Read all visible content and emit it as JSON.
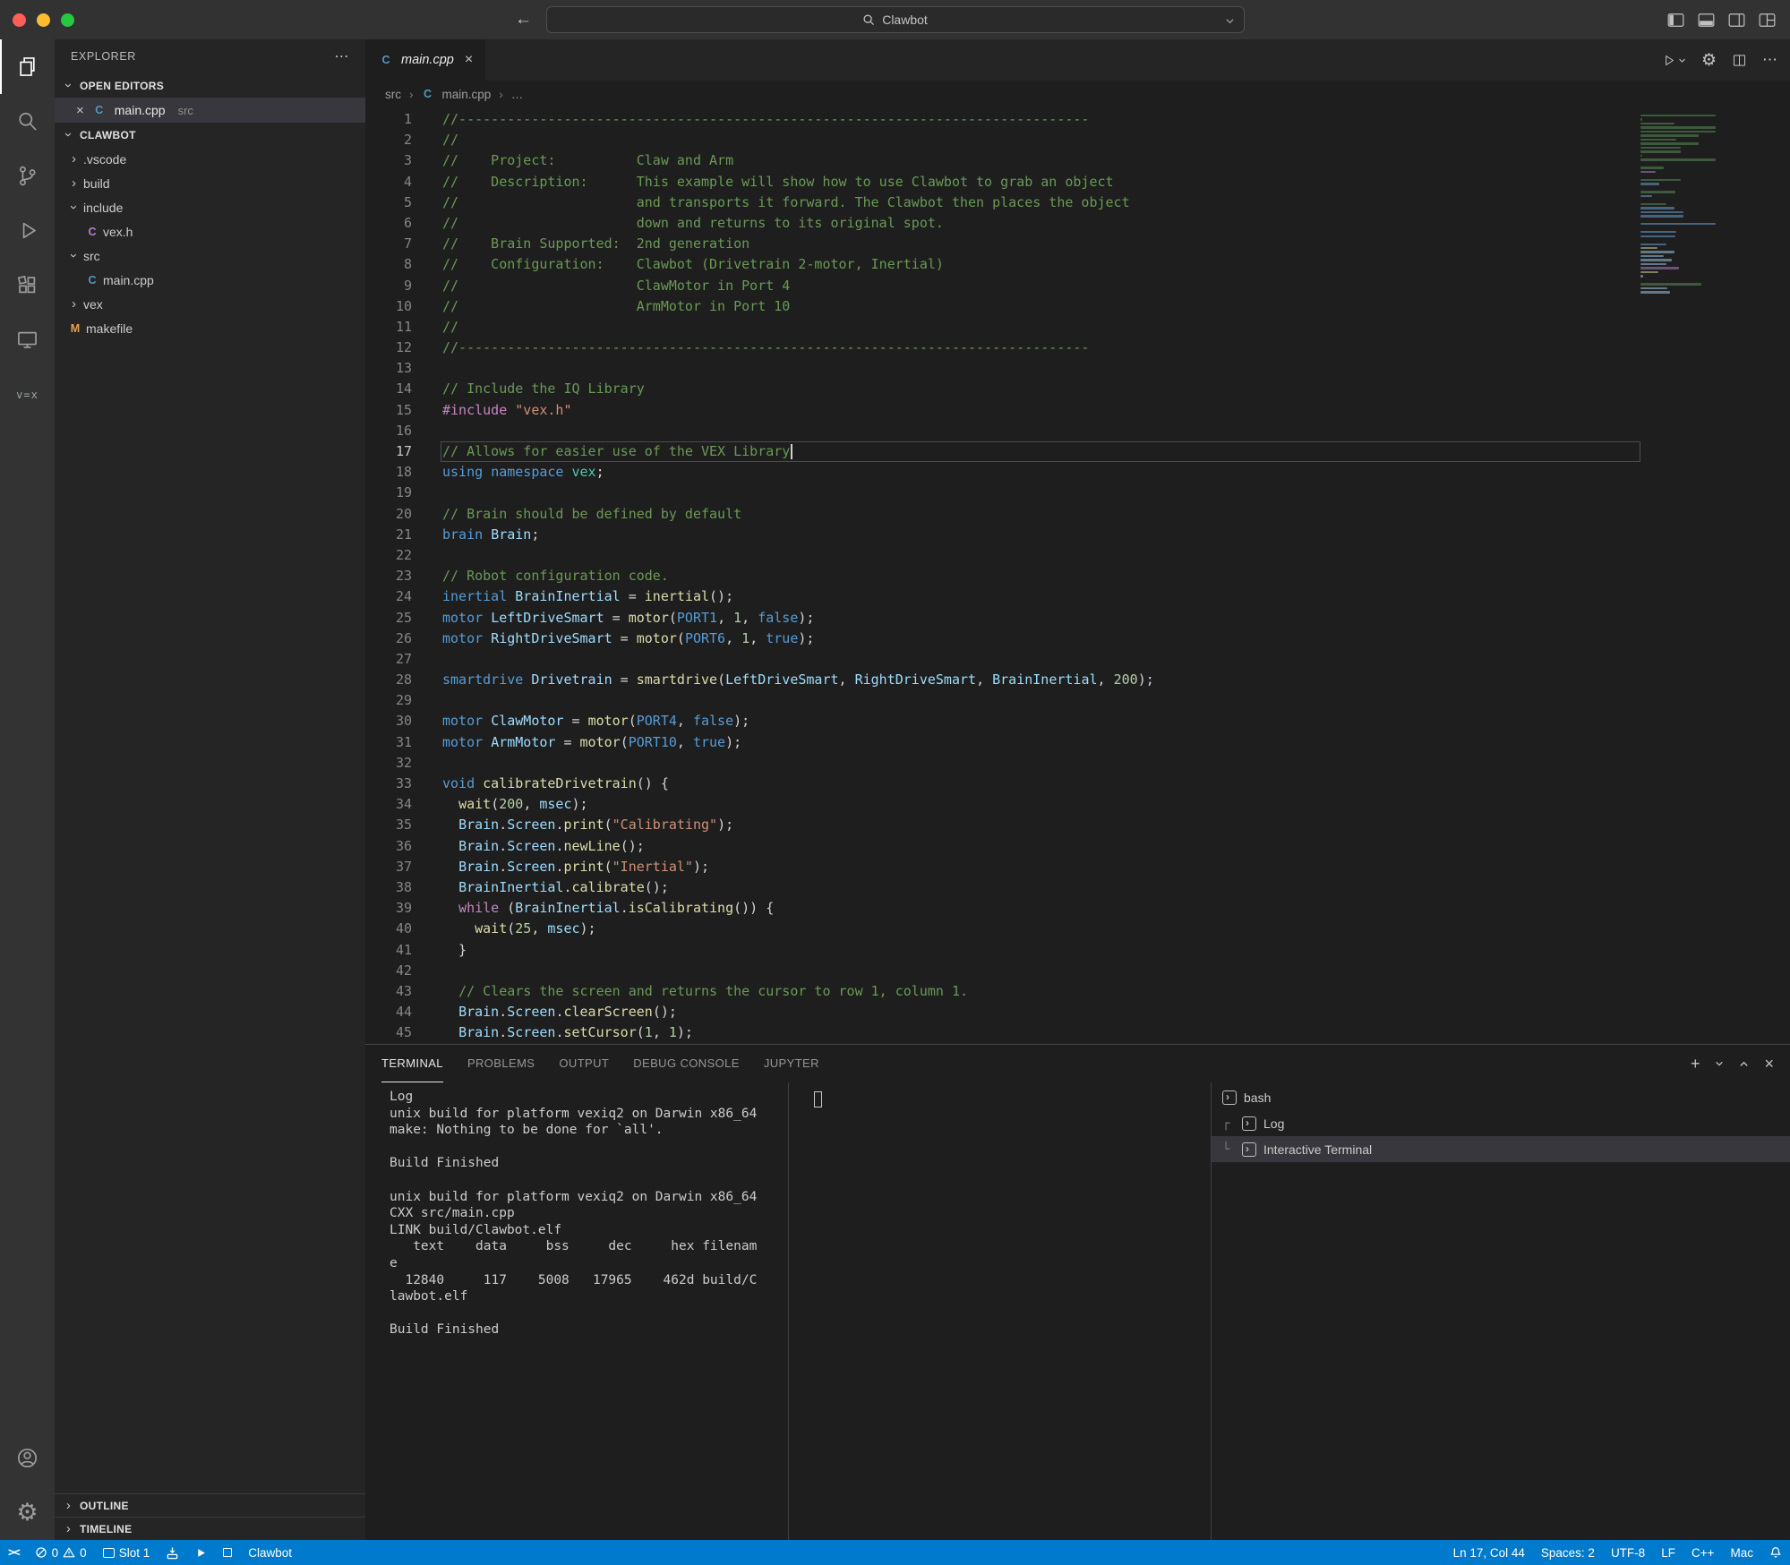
{
  "titlebar": {
    "search_value": "Clawbot"
  },
  "icons": {
    "close": "×",
    "more": "⋯",
    "plus": "+",
    "back": "←",
    "forward": "→"
  },
  "sidebar": {
    "title": "EXPLORER",
    "open_editors_header": "OPEN EDITORS",
    "open_editor_item": {
      "label": "main.cpp",
      "detail": "src",
      "icon_glyph": "C",
      "icon_color": "#519aba"
    },
    "workspace_header": "CLAWBOT",
    "tree": [
      {
        "label": ".vscode",
        "type": "folder",
        "depth": 0,
        "expanded": false
      },
      {
        "label": "build",
        "type": "folder",
        "depth": 0,
        "expanded": false
      },
      {
        "label": "include",
        "type": "folder",
        "depth": 0,
        "expanded": true
      },
      {
        "label": "vex.h",
        "type": "file",
        "depth": 1,
        "glyph": "C",
        "color": "#b180d7"
      },
      {
        "label": "src",
        "type": "folder",
        "depth": 0,
        "expanded": true
      },
      {
        "label": "main.cpp",
        "type": "file",
        "depth": 1,
        "glyph": "C",
        "color": "#519aba"
      },
      {
        "label": "vex",
        "type": "folder",
        "depth": 0,
        "expanded": false
      },
      {
        "label": "makefile",
        "type": "file",
        "depth": 0,
        "glyph": "M",
        "color": "#e8a04c"
      }
    ],
    "outline_label": "OUTLINE",
    "timeline_label": "TIMELINE"
  },
  "editor": {
    "tab_label": "main.cpp",
    "tab_icon": {
      "glyph": "C",
      "color": "#519aba"
    },
    "breadcrumbs": [
      "src",
      "main.cpp",
      "…"
    ],
    "cursor_line": 17,
    "lines": [
      [
        [
          "c",
          "//------------------------------------------------------------------------------"
        ]
      ],
      [
        [
          "c",
          "//"
        ]
      ],
      [
        [
          "c",
          "//    Project:          Claw and Arm"
        ]
      ],
      [
        [
          "c",
          "//    Description:      This example will show how to use Clawbot to grab an object"
        ]
      ],
      [
        [
          "c",
          "//                      and transports it forward. The Clawbot then places the object"
        ]
      ],
      [
        [
          "c",
          "//                      down and returns to its original spot."
        ]
      ],
      [
        [
          "c",
          "//    Brain Supported:  2nd generation"
        ]
      ],
      [
        [
          "c",
          "//    Configuration:    Clawbot (Drivetrain 2-motor, Inertial)"
        ]
      ],
      [
        [
          "c",
          "//                      ClawMotor in Port 4"
        ]
      ],
      [
        [
          "c",
          "//                      ArmMotor in Port 10"
        ]
      ],
      [
        [
          "c",
          "//"
        ]
      ],
      [
        [
          "c",
          "//------------------------------------------------------------------------------"
        ]
      ],
      [],
      [
        [
          "c",
          "// Include the IQ Library"
        ]
      ],
      [
        [
          "m",
          "#include"
        ],
        [
          "p",
          " "
        ],
        [
          "s",
          "\"vex.h\""
        ]
      ],
      [],
      [
        [
          "c",
          "// Allows for easier use of the VEX Library"
        ]
      ],
      [
        [
          "k",
          "using"
        ],
        [
          "p",
          " "
        ],
        [
          "k",
          "namespace"
        ],
        [
          "p",
          " "
        ],
        [
          "e",
          "vex"
        ],
        [
          "p",
          ";"
        ]
      ],
      [],
      [
        [
          "c",
          "// Brain should be defined by default"
        ]
      ],
      [
        [
          "k",
          "brain"
        ],
        [
          "p",
          " "
        ],
        [
          "v",
          "Brain"
        ],
        [
          "p",
          ";"
        ]
      ],
      [],
      [
        [
          "c",
          "// Robot configuration code."
        ]
      ],
      [
        [
          "k",
          "inertial"
        ],
        [
          "p",
          " "
        ],
        [
          "v",
          "BrainInertial"
        ],
        [
          "p",
          " = "
        ],
        [
          "f",
          "inertial"
        ],
        [
          "p",
          "();"
        ]
      ],
      [
        [
          "k",
          "motor"
        ],
        [
          "p",
          " "
        ],
        [
          "v",
          "LeftDriveSmart"
        ],
        [
          "p",
          " = "
        ],
        [
          "f",
          "motor"
        ],
        [
          "p",
          "("
        ],
        [
          "k",
          "PORT1"
        ],
        [
          "p",
          ", "
        ],
        [
          "n",
          "1"
        ],
        [
          "p",
          ", "
        ],
        [
          "k",
          "false"
        ],
        [
          "p",
          ");"
        ]
      ],
      [
        [
          "k",
          "motor"
        ],
        [
          "p",
          " "
        ],
        [
          "v",
          "RightDriveSmart"
        ],
        [
          "p",
          " = "
        ],
        [
          "f",
          "motor"
        ],
        [
          "p",
          "("
        ],
        [
          "k",
          "PORT6"
        ],
        [
          "p",
          ", "
        ],
        [
          "n",
          "1"
        ],
        [
          "p",
          ", "
        ],
        [
          "k",
          "true"
        ],
        [
          "p",
          ");"
        ]
      ],
      [],
      [
        [
          "k",
          "smartdrive"
        ],
        [
          "p",
          " "
        ],
        [
          "v",
          "Drivetrain"
        ],
        [
          "p",
          " = "
        ],
        [
          "f",
          "smartdrive"
        ],
        [
          "p",
          "("
        ],
        [
          "v",
          "LeftDriveSmart"
        ],
        [
          "p",
          ", "
        ],
        [
          "v",
          "RightDriveSmart"
        ],
        [
          "p",
          ", "
        ],
        [
          "v",
          "BrainInertial"
        ],
        [
          "p",
          ", "
        ],
        [
          "n",
          "200"
        ],
        [
          "p",
          ");"
        ]
      ],
      [],
      [
        [
          "k",
          "motor"
        ],
        [
          "p",
          " "
        ],
        [
          "v",
          "ClawMotor"
        ],
        [
          "p",
          " = "
        ],
        [
          "f",
          "motor"
        ],
        [
          "p",
          "("
        ],
        [
          "k",
          "PORT4"
        ],
        [
          "p",
          ", "
        ],
        [
          "k",
          "false"
        ],
        [
          "p",
          ");"
        ]
      ],
      [
        [
          "k",
          "motor"
        ],
        [
          "p",
          " "
        ],
        [
          "v",
          "ArmMotor"
        ],
        [
          "p",
          " = "
        ],
        [
          "f",
          "motor"
        ],
        [
          "p",
          "("
        ],
        [
          "k",
          "PORT10"
        ],
        [
          "p",
          ", "
        ],
        [
          "k",
          "true"
        ],
        [
          "p",
          ");"
        ]
      ],
      [],
      [
        [
          "k",
          "void"
        ],
        [
          "p",
          " "
        ],
        [
          "f",
          "calibrateDrivetrain"
        ],
        [
          "p",
          "() {"
        ]
      ],
      [
        [
          "p",
          "  "
        ],
        [
          "f",
          "wait"
        ],
        [
          "p",
          "("
        ],
        [
          "n",
          "200"
        ],
        [
          "p",
          ", "
        ],
        [
          "v",
          "msec"
        ],
        [
          "p",
          ");"
        ]
      ],
      [
        [
          "p",
          "  "
        ],
        [
          "v",
          "Brain"
        ],
        [
          "p",
          "."
        ],
        [
          "v",
          "Screen"
        ],
        [
          "p",
          "."
        ],
        [
          "f",
          "print"
        ],
        [
          "p",
          "("
        ],
        [
          "s",
          "\"Calibrating\""
        ],
        [
          "p",
          ");"
        ]
      ],
      [
        [
          "p",
          "  "
        ],
        [
          "v",
          "Brain"
        ],
        [
          "p",
          "."
        ],
        [
          "v",
          "Screen"
        ],
        [
          "p",
          "."
        ],
        [
          "f",
          "newLine"
        ],
        [
          "p",
          "();"
        ]
      ],
      [
        [
          "p",
          "  "
        ],
        [
          "v",
          "Brain"
        ],
        [
          "p",
          "."
        ],
        [
          "v",
          "Screen"
        ],
        [
          "p",
          "."
        ],
        [
          "f",
          "print"
        ],
        [
          "p",
          "("
        ],
        [
          "s",
          "\"Inertial\""
        ],
        [
          "p",
          ");"
        ]
      ],
      [
        [
          "p",
          "  "
        ],
        [
          "v",
          "BrainInertial"
        ],
        [
          "p",
          "."
        ],
        [
          "f",
          "calibrate"
        ],
        [
          "p",
          "();"
        ]
      ],
      [
        [
          "p",
          "  "
        ],
        [
          "m",
          "while"
        ],
        [
          "p",
          " ("
        ],
        [
          "v",
          "BrainInertial"
        ],
        [
          "p",
          "."
        ],
        [
          "f",
          "isCalibrating"
        ],
        [
          "p",
          "()) {"
        ]
      ],
      [
        [
          "p",
          "    "
        ],
        [
          "f",
          "wait"
        ],
        [
          "p",
          "("
        ],
        [
          "n",
          "25"
        ],
        [
          "p",
          ", "
        ],
        [
          "v",
          "msec"
        ],
        [
          "p",
          ");"
        ]
      ],
      [
        [
          "p",
          "  }"
        ]
      ],
      [],
      [
        [
          "p",
          "  "
        ],
        [
          "c",
          "// Clears the screen and returns the cursor to row 1, column 1."
        ]
      ],
      [
        [
          "p",
          "  "
        ],
        [
          "v",
          "Brain"
        ],
        [
          "p",
          "."
        ],
        [
          "v",
          "Screen"
        ],
        [
          "p",
          "."
        ],
        [
          "f",
          "clearScreen"
        ],
        [
          "p",
          "();"
        ]
      ],
      [
        [
          "p",
          "  "
        ],
        [
          "v",
          "Brain"
        ],
        [
          "p",
          "."
        ],
        [
          "v",
          "Screen"
        ],
        [
          "p",
          "."
        ],
        [
          "f",
          "setCursor"
        ],
        [
          "p",
          "("
        ],
        [
          "n",
          "1"
        ],
        [
          "p",
          ", "
        ],
        [
          "n",
          "1"
        ],
        [
          "p",
          ");"
        ]
      ]
    ]
  },
  "panel": {
    "tabs": [
      {
        "label": "TERMINAL",
        "active": true
      },
      {
        "label": "PROBLEMS",
        "active": false
      },
      {
        "label": "OUTPUT",
        "active": false
      },
      {
        "label": "DEBUG CONSOLE",
        "active": false
      },
      {
        "label": "JUPYTER",
        "active": false
      }
    ],
    "terminal_lines": [
      "Log",
      "unix build for platform vexiq2 on Darwin x86_64",
      "make: Nothing to be done for `all'.",
      "",
      "Build Finished",
      "",
      "unix build for platform vexiq2 on Darwin x86_64",
      "CXX src/main.cpp",
      "LINK build/Clawbot.elf",
      "   text    data     bss     dec     hex filenam",
      "e",
      "  12840     117    5008   17965    462d build/C",
      "lawbot.elf",
      "",
      "Build Finished"
    ],
    "terminal_list": [
      {
        "label": "bash",
        "connector": "",
        "selected": false,
        "icon": "terminal-icon"
      },
      {
        "label": "Log",
        "connector": "┌",
        "selected": false,
        "icon": "terminal-icon"
      },
      {
        "label": "Interactive Terminal",
        "connector": "└",
        "selected": true,
        "icon": "terminal-icon"
      }
    ]
  },
  "status": {
    "errors": "0",
    "warnings": "0",
    "slot": "Slot 1",
    "project": "Clawbot",
    "line_col": "Ln 17, Col 44",
    "indent": "Spaces: 2",
    "encoding": "UTF-8",
    "eol": "LF",
    "language": "C++",
    "os": "Mac"
  }
}
